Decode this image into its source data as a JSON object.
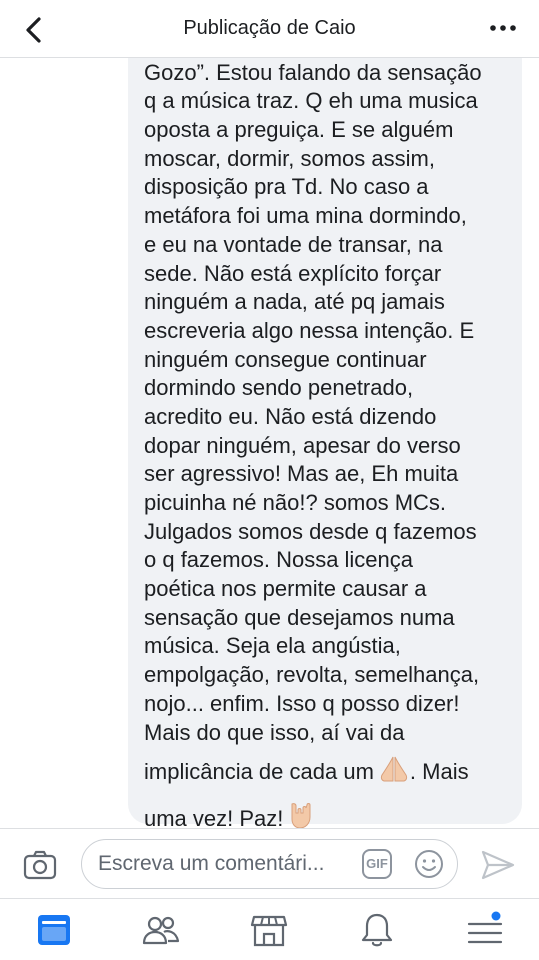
{
  "header": {
    "title": "Publicação de Caio"
  },
  "post": {
    "lines": [
      "Gozo”. Estou falando da sensação",
      "q a música traz. Q eh uma musica",
      "oposta a preguiça. E se alguém",
      "moscar, dormir, somos assim,",
      "disposição pra Td. No caso a",
      "metáfora foi uma mina dormindo,",
      "e eu na vontade de transar, na",
      "sede. Não está explícito forçar",
      "ninguém a nada, até pq jamais",
      "escreveria algo nessa intenção. E",
      "ninguém consegue continuar",
      "dormindo sendo penetrado,",
      "acredito eu. Não está dizendo",
      "dopar ninguém, apesar do verso",
      "ser agressivo! Mas ae, Eh muita",
      "picuinha né não!? somos MCs.",
      "Julgados somos desde q fazemos",
      "o q fazemos. Nossa licença",
      "poética nos permite causar a",
      "sensação que desejamos numa",
      "música. Seja ela angústia,",
      "empolgação, revolta, semelhança,",
      "nojo... enfim. Isso q posso dizer!",
      "Mais do que isso, aí vai da"
    ],
    "line_praying_before": "implicância de cada um",
    "line_praying_after": ". Mais",
    "line_last": "uma vez! Paz!",
    "emoji_1": "praying-hands-emoji",
    "emoji_2": "love-you-gesture-emoji"
  },
  "composer": {
    "placeholder": "Escreva um comentári...",
    "gif_label": "GIF"
  },
  "tabs": [
    "news-feed-icon",
    "friends-icon",
    "marketplace-icon",
    "notifications-icon",
    "menu-icon"
  ],
  "colors": {
    "accent": "#1877f2",
    "bubble": "#f0f2f5",
    "icon_gray": "#606770"
  }
}
